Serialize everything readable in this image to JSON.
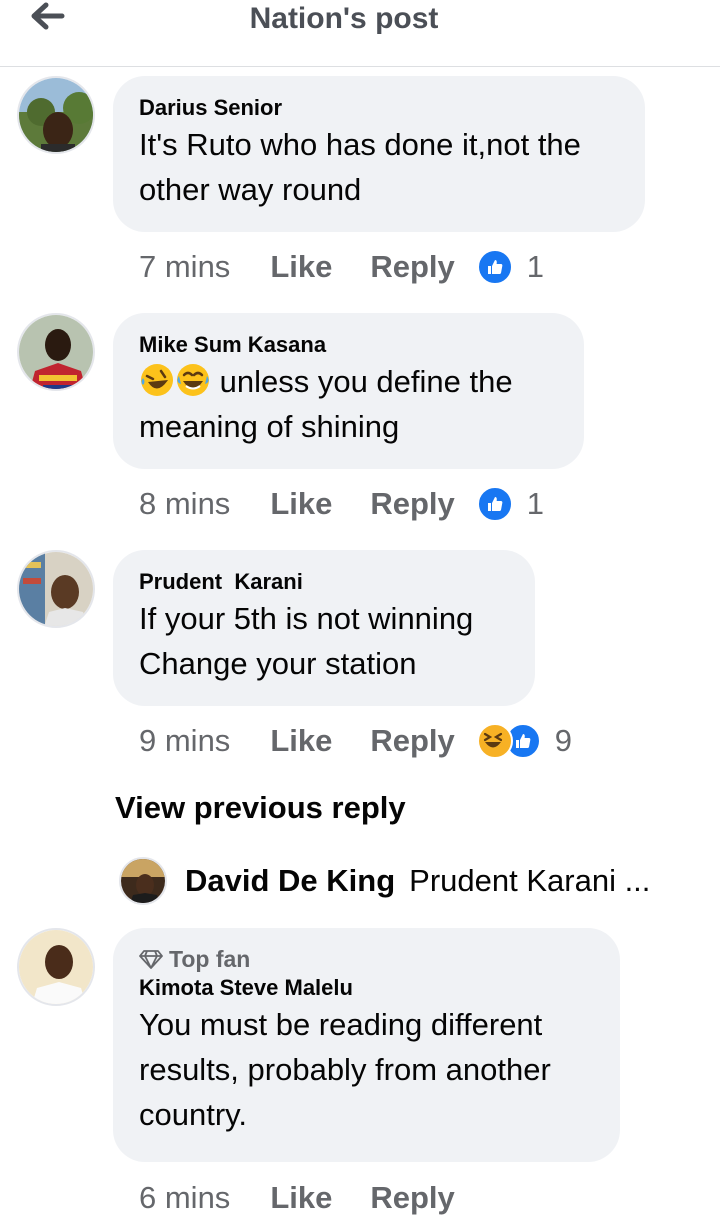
{
  "header": {
    "title": "Nation's post",
    "back_icon": "arrow-left-icon"
  },
  "comments": [
    {
      "author": "Darius Senior",
      "text": "It's Ruto who has done it,not the other way round",
      "time": "7 mins",
      "like_label": "Like",
      "reply_label": "Reply",
      "reactions": [
        "like"
      ],
      "reaction_count": "1"
    },
    {
      "author": "Mike Sum Kasana",
      "emoji_prefix": [
        "rofl",
        "joy"
      ],
      "text": " unless you define the meaning of shining",
      "time": "8 mins",
      "like_label": "Like",
      "reply_label": "Reply",
      "reactions": [
        "like"
      ],
      "reaction_count": "1"
    },
    {
      "author": "Prudent  Karani",
      "text": "If your 5th is not winning Change your station",
      "time": "9 mins",
      "like_label": "Like",
      "reply_label": "Reply",
      "reactions": [
        "haha",
        "like"
      ],
      "reaction_count": "9"
    },
    {
      "badge": "Top fan",
      "author": "Kimota Steve Malelu",
      "text": "You must be reading different results, probably from another country.",
      "time": "6 mins",
      "like_label": "Like",
      "reply_label": "Reply"
    }
  ],
  "view_previous": "View previous reply",
  "reply_preview": {
    "author": "David De King",
    "text": "Prudent Karani ..."
  },
  "colors": {
    "like_blue": "#1877f2",
    "bubble_bg": "#f0f2f5",
    "meta_gray": "#65676b",
    "haha_yellow": "#f7b125"
  }
}
